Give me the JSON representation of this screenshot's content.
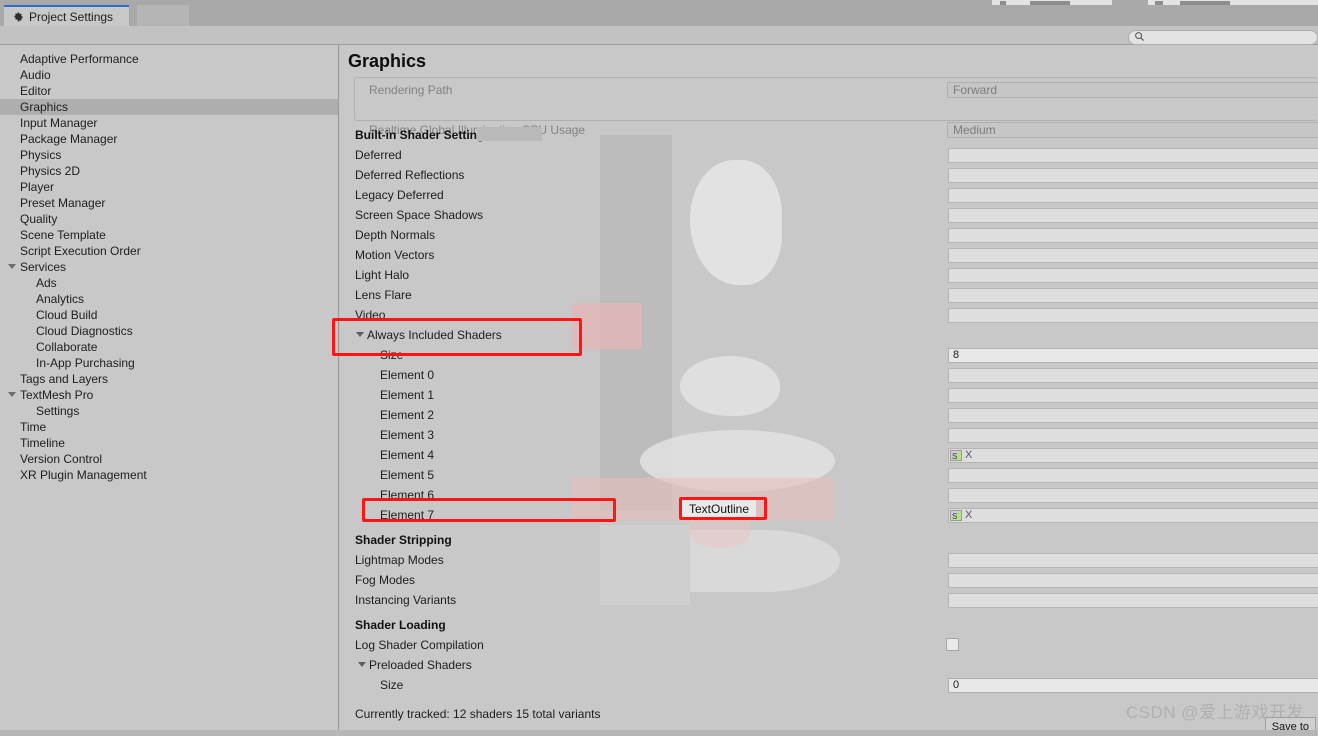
{
  "window": {
    "tab_label": "Project Settings",
    "gear_icon": "gear-icon"
  },
  "search": {
    "placeholder": "",
    "value": "",
    "icon": "search-icon"
  },
  "sidebar": {
    "items": [
      {
        "label": "Adaptive Performance",
        "depth": 0,
        "selected": false,
        "expander": false
      },
      {
        "label": "Audio",
        "depth": 0,
        "selected": false,
        "expander": false
      },
      {
        "label": "Editor",
        "depth": 0,
        "selected": false,
        "expander": false
      },
      {
        "label": "Graphics",
        "depth": 0,
        "selected": true,
        "expander": false
      },
      {
        "label": "Input Manager",
        "depth": 0,
        "selected": false,
        "expander": false
      },
      {
        "label": "Package Manager",
        "depth": 0,
        "selected": false,
        "expander": false
      },
      {
        "label": "Physics",
        "depth": 0,
        "selected": false,
        "expander": false
      },
      {
        "label": "Physics 2D",
        "depth": 0,
        "selected": false,
        "expander": false
      },
      {
        "label": "Player",
        "depth": 0,
        "selected": false,
        "expander": false
      },
      {
        "label": "Preset Manager",
        "depth": 0,
        "selected": false,
        "expander": false
      },
      {
        "label": "Quality",
        "depth": 0,
        "selected": false,
        "expander": false
      },
      {
        "label": "Scene Template",
        "depth": 0,
        "selected": false,
        "expander": false
      },
      {
        "label": "Script Execution Order",
        "depth": 0,
        "selected": false,
        "expander": false
      },
      {
        "label": "Services",
        "depth": 0,
        "selected": false,
        "expander": true
      },
      {
        "label": "Ads",
        "depth": 1,
        "selected": false,
        "expander": false
      },
      {
        "label": "Analytics",
        "depth": 1,
        "selected": false,
        "expander": false
      },
      {
        "label": "Cloud Build",
        "depth": 1,
        "selected": false,
        "expander": false
      },
      {
        "label": "Cloud Diagnostics",
        "depth": 1,
        "selected": false,
        "expander": false
      },
      {
        "label": "Collaborate",
        "depth": 1,
        "selected": false,
        "expander": false
      },
      {
        "label": "In-App Purchasing",
        "depth": 1,
        "selected": false,
        "expander": false
      },
      {
        "label": "Tags and Layers",
        "depth": 0,
        "selected": false,
        "expander": false
      },
      {
        "label": "TextMesh Pro",
        "depth": 0,
        "selected": false,
        "expander": true
      },
      {
        "label": "Settings",
        "depth": 1,
        "selected": false,
        "expander": false
      },
      {
        "label": "Time",
        "depth": 0,
        "selected": false,
        "expander": false
      },
      {
        "label": "Timeline",
        "depth": 0,
        "selected": false,
        "expander": false
      },
      {
        "label": "Version Control",
        "depth": 0,
        "selected": false,
        "expander": false
      },
      {
        "label": "XR Plugin Management",
        "depth": 0,
        "selected": false,
        "expander": false
      }
    ]
  },
  "main": {
    "title": "Graphics",
    "tier_settings": [
      {
        "label": "Rendering Path",
        "value": "Forward",
        "disabled": true
      },
      {
        "label": "Realtime Global Illumination CPU Usage",
        "value": "Medium",
        "disabled": true
      }
    ],
    "builtin_shader_settings": {
      "heading": "Built-in Shader Settings",
      "rows": [
        {
          "label": "Deferred"
        },
        {
          "label": "Deferred Reflections"
        },
        {
          "label": "Legacy Deferred"
        },
        {
          "label": "Screen Space Shadows"
        },
        {
          "label": "Depth Normals"
        },
        {
          "label": "Motion Vectors"
        },
        {
          "label": "Light Halo"
        },
        {
          "label": "Lens Flare"
        },
        {
          "label": "Video"
        }
      ]
    },
    "always_included_shaders": {
      "heading": "Always Included Shaders",
      "expanded": true,
      "size_label": "Size",
      "size_value": "8",
      "elements": [
        {
          "label": "Element 0",
          "has_icon": false
        },
        {
          "label": "Element 1",
          "has_icon": false
        },
        {
          "label": "Element 2",
          "has_icon": false
        },
        {
          "label": "Element 3",
          "has_icon": false
        },
        {
          "label": "Element 4",
          "has_icon": true
        },
        {
          "label": "Element 5",
          "has_icon": false
        },
        {
          "label": "Element 6",
          "has_icon": false
        },
        {
          "label": "Element 7",
          "has_icon": true
        }
      ],
      "selected_shader_tooltip": "TextOutline"
    },
    "shader_stripping": {
      "heading": "Shader Stripping",
      "rows": [
        {
          "label": "Lightmap Modes"
        },
        {
          "label": "Fog Modes"
        },
        {
          "label": "Instancing Variants"
        }
      ]
    },
    "shader_loading": {
      "heading": "Shader Loading",
      "log_shader_compilation_label": "Log Shader Compilation",
      "log_shader_compilation_checked": false,
      "preloaded_shaders_label": "Preloaded Shaders",
      "preloaded_expanded": true,
      "preloaded_size_label": "Size",
      "preloaded_size_value": "0"
    },
    "status_note": "Currently tracked: 12 shaders 15 total variants"
  },
  "footer": {
    "watermark": "CSDN @爱上游戏开发",
    "save_button": "Save to"
  },
  "colors": {
    "annotation_red": "#ff1515",
    "panel_bg": "#c8c8c8",
    "chrome_bg": "#a9a9a9",
    "selection": "#aeaeae",
    "tab_accent": "#2c6fc4"
  }
}
